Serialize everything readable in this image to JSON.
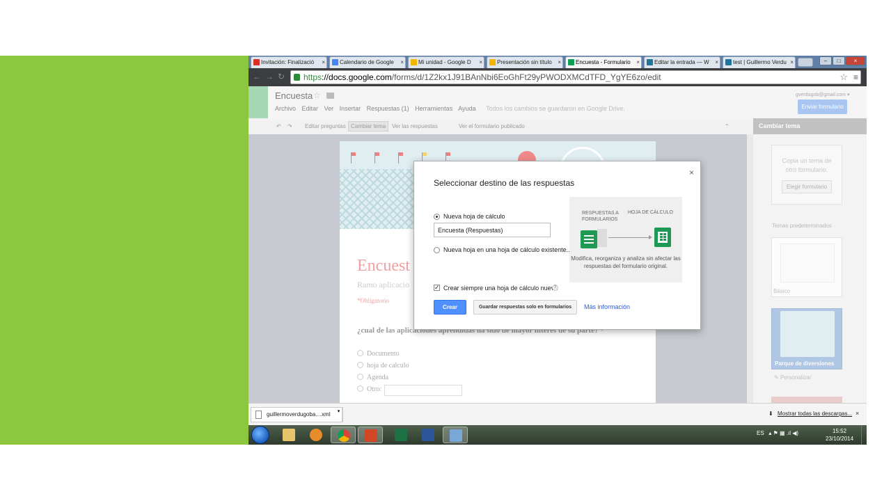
{
  "browser": {
    "tabs": [
      {
        "label": "Invitación: Finalizació",
        "icon": "gmail-icon",
        "color": "#d93025"
      },
      {
        "label": "Calendario de Google",
        "icon": "calendar-icon",
        "color": "#4285f4"
      },
      {
        "label": "Mi unidad - Google D",
        "icon": "drive-icon",
        "color": "#f4b400"
      },
      {
        "label": "Presentación sin título",
        "icon": "slides-icon",
        "color": "#f4b400"
      },
      {
        "label": "Encuesta - Formulario",
        "icon": "forms-icon",
        "color": "#0f9d58"
      },
      {
        "label": "Editar la entrada — W",
        "icon": "wordpress-icon",
        "color": "#21759b"
      },
      {
        "label": "test | Guillermo Verdu",
        "icon": "wordpress-icon",
        "color": "#21759b"
      }
    ],
    "url_scheme": "https",
    "url_host": "://docs.google.com",
    "url_path": "/forms/d/1Z2kx1J91BAnNbi6EoGhFt29yPWODXMCdTFD_YgYE6zo/edit"
  },
  "forms_header": {
    "doc_title": "Encuesta",
    "menu": [
      "Archivo",
      "Editar",
      "Ver",
      "Insertar",
      "Respuestas (1)",
      "Herramientas",
      "Ayuda"
    ],
    "save_status": "Todos los cambios se guardaron en Google Drive.",
    "user_email": "gverdugob@gmail.com ▾",
    "send_button": "Enviar formulario"
  },
  "subtoolbar": {
    "edit_questions": "Editar preguntas",
    "change_theme": "Cambiar tema",
    "view_responses": "Ver las respuestas",
    "view_published": "Ver el formulario publicado"
  },
  "form_preview": {
    "title": "Encuest",
    "description": "Ramo aplicacio",
    "required_note": "*Obligatorio",
    "question": "¿cual de las aplicaciones aprendidas ha sido de mayor interes de su parte? *",
    "options": [
      "Documento",
      "hoja de calculo",
      "Agenda",
      "Otro:"
    ]
  },
  "theme_panel": {
    "header": "Cambiar tema",
    "copy_text": "Copia un tema de otro formulario.",
    "choose_button": "Elegir formulario",
    "predefined_label": "Temas predeterminados",
    "theme1_name": "Básico",
    "theme2_name": "Parque de diversiones",
    "customize": "Personalizar"
  },
  "dialog": {
    "title": "Seleccionar destino de las respuestas",
    "close": "×",
    "option_new_sheet": "Nueva hoja de cálculo",
    "sheet_name_value": "Encuesta (Respuestas)",
    "option_existing": "Nueva hoja en una hoja de cálculo existente...",
    "info_label_forms": "RESPUESTAS A FORMULARIOS",
    "info_label_sheet": "HOJA DE CÁLCULO",
    "info_desc": "Modifica, reorganiza y analiza sin afectar las respuestas del formulario original.",
    "checkbox_label": "Crear siempre una hoja de cálculo nueva",
    "help": "?",
    "create_button": "Crear",
    "save_forms_only_button": "Guardar respuestas solo en formularios",
    "more_info_link": "Más información"
  },
  "downloads": {
    "file": "guillermoverdugoba....xml",
    "show_all": "Mostrar todas las descargas...",
    "close": "×"
  },
  "taskbar": {
    "language": "ES",
    "time": "15:52",
    "date": "23/10/2014"
  },
  "colors": {
    "slide_accent": "#8dc63f",
    "primary_button": "#4d90fe",
    "link": "#2a5bd7",
    "sheets_green": "#1e9a54"
  }
}
